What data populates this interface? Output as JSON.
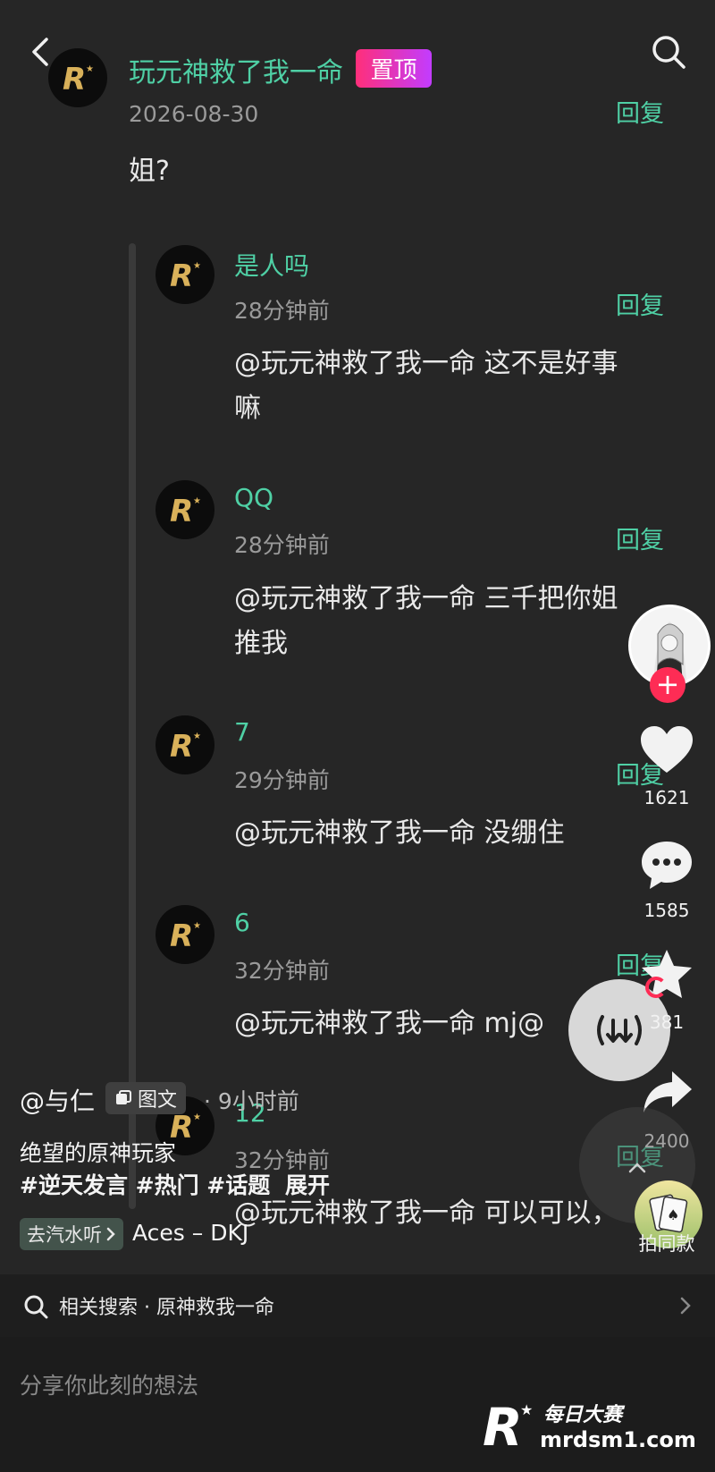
{
  "header": {
    "back_icon": "chevron-left-icon",
    "search_icon": "search-icon"
  },
  "main_comment": {
    "username": "玩元神救了我一命",
    "pin_label": "置顶",
    "date": "2026-08-30",
    "reply_label": "回复",
    "content": "姐?"
  },
  "replies": [
    {
      "username": "是人吗",
      "time": "28分钟前",
      "reply_label": "回复",
      "content_line1": "@玩元神救了我一命 这不是好事",
      "content_line2": "嘛"
    },
    {
      "username": "QQ",
      "time": "28分钟前",
      "reply_label": "回复",
      "content_line1": "@玩元神救了我一命 三千把你姐",
      "content_line2": "推我"
    },
    {
      "username": "7",
      "time": "29分钟前",
      "reply_label": "回复",
      "content_line1": "@玩元神救了我一命 没绷住",
      "content_line2": ""
    },
    {
      "username": "6",
      "time": "32分钟前",
      "reply_label": "回复",
      "content_line1": "@玩元神救了我一命 mj@",
      "content_line2": ""
    },
    {
      "username": "12",
      "time": "32分钟前",
      "reply_label": "回复",
      "content_line1": "@玩元神救了我一命 可以可以，",
      "content_line2": ""
    }
  ],
  "sidebar": {
    "like_count": "1621",
    "comment_count": "1585",
    "favorite_count": "381",
    "share_count": "2400",
    "same_style_label": "拍同款"
  },
  "post_info": {
    "author": "@与仁",
    "type_badge": "图文",
    "time_ago": "· 9小时前",
    "title": "绝望的原神玩家",
    "hashtags": "#逆天发言 #热门 #话题",
    "expand_label": "展开",
    "music_badge": "去汽水听",
    "music_name": "Aces – DKJ"
  },
  "bottom": {
    "related_search": "相关搜索 · 原神救我一命",
    "comment_placeholder": "分享你此刻的想法"
  },
  "watermark": {
    "line1": "每日大赛",
    "line2": "mrdsm1.com"
  },
  "colors": {
    "accent_green": "#4fd0a5",
    "pin_gradient_start": "#ff2f7a",
    "pin_gradient_end": "#c23cff",
    "follow_red": "#fe2c55"
  }
}
